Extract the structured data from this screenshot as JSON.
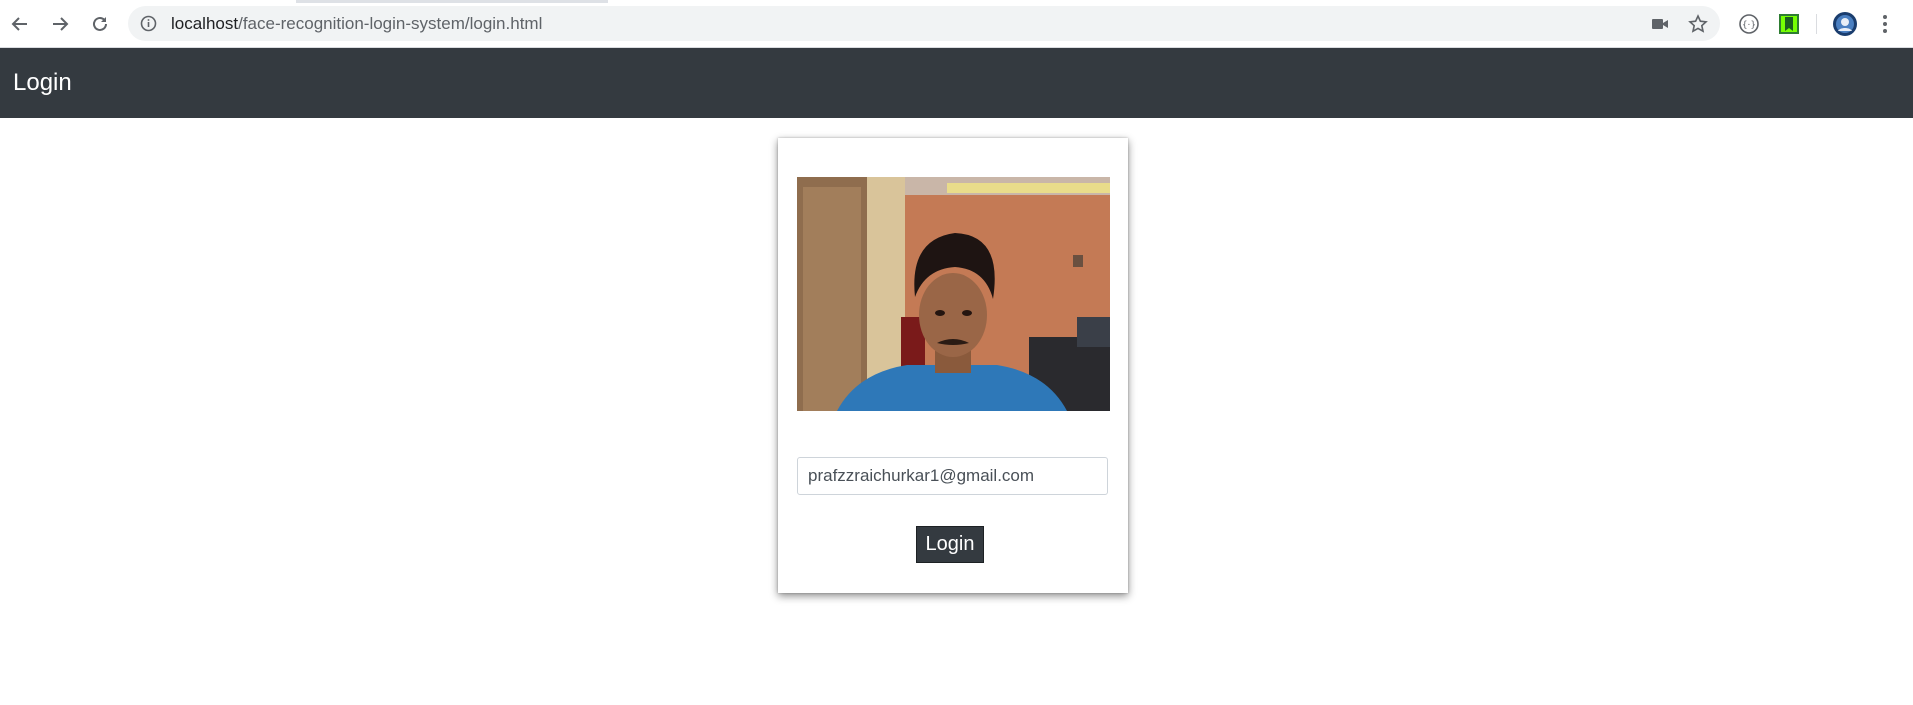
{
  "browser": {
    "url_host": "localhost",
    "url_path": "/face-recognition-login-system/login.html",
    "icons": {
      "back": "back-arrow-icon",
      "forward": "forward-arrow-icon",
      "reload": "reload-icon",
      "site_info": "info-icon",
      "camera": "camera-icon",
      "bookmark": "star-icon",
      "extension1": "extension-icon",
      "extension2": "bookmark-extension-icon",
      "profile": "profile-avatar-icon",
      "menu": "kebab-menu-icon"
    }
  },
  "navbar": {
    "brand": "Login",
    "background": "#343a40"
  },
  "login_card": {
    "email_value": "prafzzraichurkar1@gmail.com",
    "button_label": "Login"
  }
}
